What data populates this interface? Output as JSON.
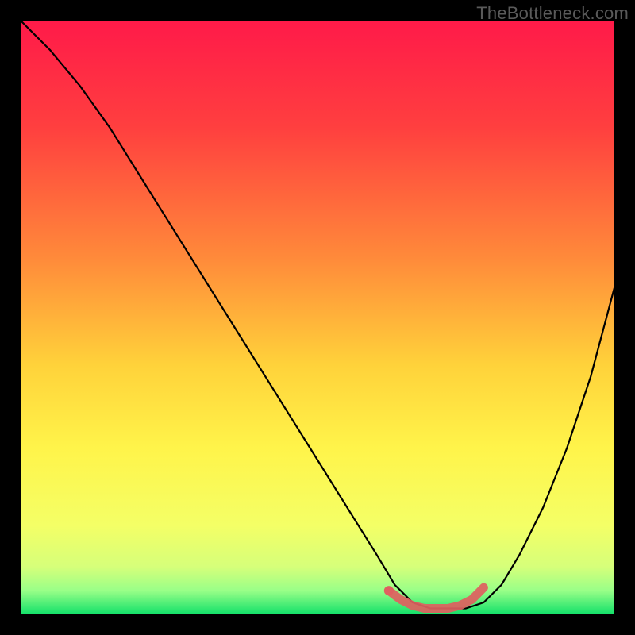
{
  "watermark": "TheBottleneck.com",
  "chart_data": {
    "type": "line",
    "title": "",
    "xlabel": "",
    "ylabel": "",
    "xlim": [
      0,
      100
    ],
    "ylim": [
      0,
      100
    ],
    "background_gradient": {
      "stops": [
        {
          "offset": 0,
          "color": "#ff1a49"
        },
        {
          "offset": 18,
          "color": "#ff3f3f"
        },
        {
          "offset": 40,
          "color": "#ff8a3a"
        },
        {
          "offset": 58,
          "color": "#ffd23a"
        },
        {
          "offset": 72,
          "color": "#fff44a"
        },
        {
          "offset": 85,
          "color": "#f4ff66"
        },
        {
          "offset": 92,
          "color": "#d6ff7a"
        },
        {
          "offset": 96,
          "color": "#99ff88"
        },
        {
          "offset": 100,
          "color": "#12e06a"
        }
      ]
    },
    "series": [
      {
        "name": "bottleneck-curve",
        "color": "#000000",
        "x": [
          0,
          5,
          10,
          15,
          20,
          25,
          30,
          35,
          40,
          45,
          50,
          55,
          60,
          63,
          66,
          69,
          72,
          75,
          78,
          81,
          84,
          88,
          92,
          96,
          100
        ],
        "y": [
          100,
          95,
          89,
          82,
          74,
          66,
          58,
          50,
          42,
          34,
          26,
          18,
          10,
          5,
          2,
          1,
          1,
          1,
          2,
          5,
          10,
          18,
          28,
          40,
          55
        ]
      },
      {
        "name": "optimal-range-marker",
        "color": "#e06060",
        "x": [
          62,
          64,
          66,
          68,
          70,
          72,
          74,
          76,
          78
        ],
        "y": [
          4.0,
          2.5,
          1.5,
          1.0,
          1.0,
          1.0,
          1.5,
          2.5,
          4.5
        ]
      }
    ]
  }
}
